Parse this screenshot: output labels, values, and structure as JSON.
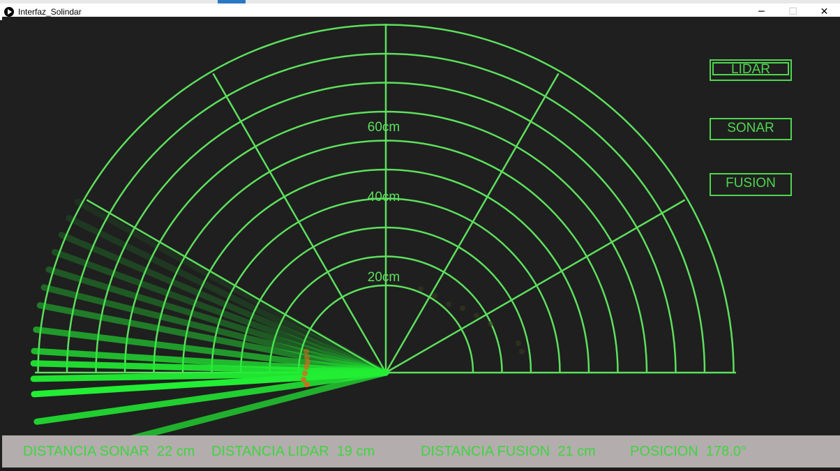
{
  "window": {
    "title": "Interfaz_Solindar",
    "minimize_glyph": "─",
    "maximize_glyph": "☐",
    "close_glyph": "✕"
  },
  "radar": {
    "range_labels": [
      "20cm",
      "40cm",
      "60cm"
    ],
    "colors": {
      "grid": "#5de05d",
      "sweep": "#22ee33",
      "hit": "#e0641e",
      "background": "#1f1f1f"
    }
  },
  "modes": {
    "lidar_label": "LIDAR",
    "sonar_label": "SONAR",
    "fusion_label": "FUSION",
    "active": "LIDAR"
  },
  "status": {
    "sonar": {
      "label": "DISTANCIA SONAR",
      "value": "22",
      "unit": "cm"
    },
    "lidar": {
      "label": "DISTANCIA LIDAR",
      "value": "19",
      "unit": "cm"
    },
    "fusion": {
      "label": "DISTANCIA FUSION",
      "value": "21",
      "unit": "cm"
    },
    "position": {
      "label": "POSICION",
      "value": "178.0°"
    }
  }
}
